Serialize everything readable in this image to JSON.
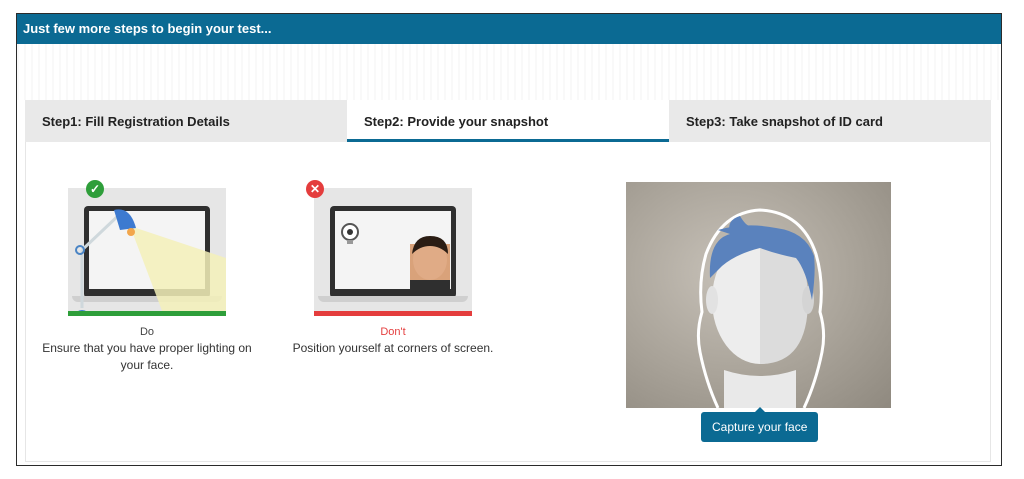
{
  "header": {
    "title": "Just few more steps to begin your test..."
  },
  "tabs": [
    {
      "label": "Step1: Fill Registration Details",
      "active": false
    },
    {
      "label": "Step2: Provide your snapshot",
      "active": true
    },
    {
      "label": "Step3: Take snapshot of ID card",
      "active": false
    }
  ],
  "examples": {
    "do": {
      "label": "Do",
      "description": "Ensure that you have proper lighting on your face.",
      "color": "#2e9e3a",
      "icon": "check-icon"
    },
    "dont": {
      "label": "Don't",
      "description": "Position yourself at corners of screen.",
      "color": "#e43d3d",
      "icon": "cross-icon"
    }
  },
  "camera": {
    "button_label": "Capture your face",
    "accent": "#0b6a93"
  },
  "colors": {
    "brand": "#0b6a93",
    "tab_bg": "#e9e9e9"
  }
}
